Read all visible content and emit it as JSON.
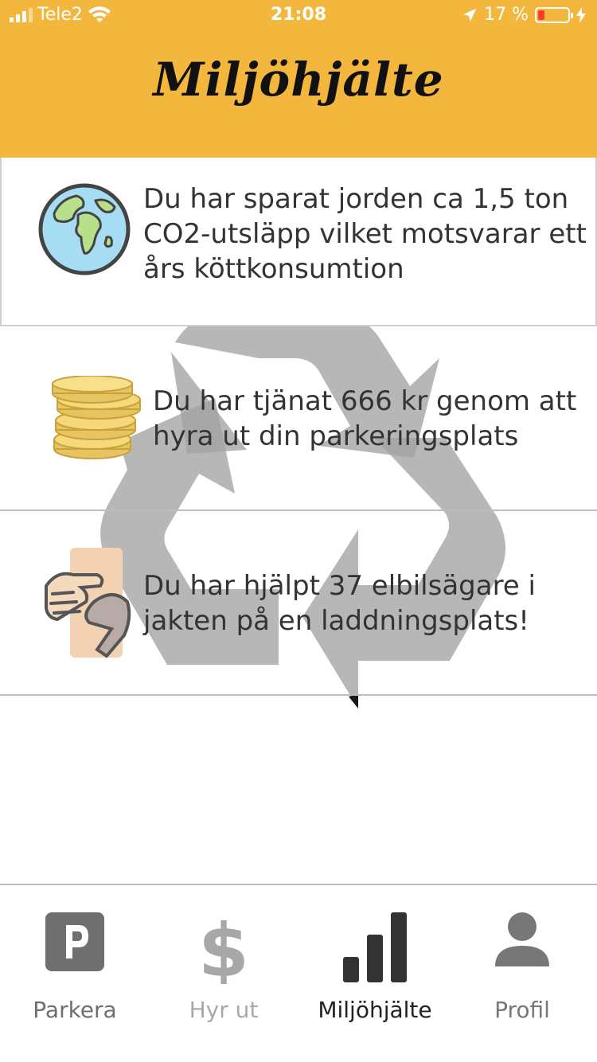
{
  "status_bar": {
    "carrier": "Tele2",
    "time": "21:08",
    "battery": "17 %"
  },
  "header": {
    "title": "Miljöhjälte",
    "background": "#f4b73e"
  },
  "stats": [
    {
      "icon": "globe-icon",
      "text": "Du har sparat jorden ca 1,5 ton CO2-utsläpp vilket motsvarar ett års köttkonsumtion"
    },
    {
      "icon": "coins-icon",
      "text": "Du har tjänat 666 kr genom att hyra ut din parkeringsplats"
    },
    {
      "icon": "helping-hand-icon",
      "text": "Du har hjälpt 37 elbilsägare i jakten på en laddningsplats!"
    }
  ],
  "tabs": [
    {
      "label": "Parkera",
      "icon": "parking-icon"
    },
    {
      "label": "Hyr ut",
      "icon": "dollar-icon"
    },
    {
      "label": "Miljöhjälte",
      "icon": "bar-chart-icon",
      "active": true
    },
    {
      "label": "Profil",
      "icon": "person-icon"
    }
  ]
}
